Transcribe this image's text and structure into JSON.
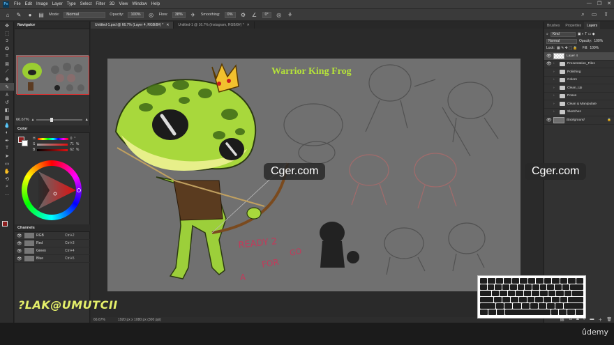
{
  "menu": [
    "File",
    "Edit",
    "Image",
    "Layer",
    "Type",
    "Select",
    "Filter",
    "3D",
    "View",
    "Window",
    "Help"
  ],
  "window_controls": [
    "—",
    "❐",
    "✕"
  ],
  "options": {
    "mode_label": "Mode:",
    "mode_value": "Normal",
    "opacity_label": "Opacity:",
    "opacity_value": "100%",
    "flow_label": "Flow:",
    "flow_value": "38%",
    "smoothing_label": "Smoothing:",
    "smoothing_value": "0%",
    "angle_value": "0°"
  },
  "doc_tabs": [
    "Untitled-1.psd @ 66.7% (Layer 4, RGB/8#) *",
    "Untitled-1 @ 16.7% (Instagram, RGB/8#) *"
  ],
  "navigator": {
    "title": "Navigator",
    "zoom": "66.67%"
  },
  "color": {
    "title": "Color",
    "rows": [
      {
        "label": "H",
        "value": "0",
        "unit": "°"
      },
      {
        "label": "S",
        "value": "71",
        "unit": "%"
      },
      {
        "label": "B",
        "value": "62",
        "unit": "%"
      }
    ],
    "foreground": "#8d1f1f"
  },
  "channels": {
    "title": "Channels",
    "rows": [
      {
        "name": "RGB",
        "shortcut": "Ctrl+2"
      },
      {
        "name": "Red",
        "shortcut": "Ctrl+3"
      },
      {
        "name": "Green",
        "shortcut": "Ctrl+4"
      },
      {
        "name": "Blue",
        "shortcut": "Ctrl+5"
      }
    ]
  },
  "canvas": {
    "title": "Warrior King Frog",
    "note_lines": [
      "READY 2",
      "GO",
      "FOR",
      "A"
    ]
  },
  "status": {
    "zoom": "66.67%",
    "size": "1920 px x 1080 px (300 ppi)"
  },
  "right_tabs": [
    "Brushes",
    "Properties",
    "Layers"
  ],
  "layers_panel": {
    "filter_label": "Kind",
    "blend_mode": "Normal",
    "opacity_label": "Opacity:",
    "opacity_value": "100%",
    "lock_label": "Lock:",
    "fill_label": "Fill:",
    "fill_value": "100%",
    "layers": [
      {
        "name": "Layer 4",
        "type": "layer",
        "selected": true,
        "visible": true
      },
      {
        "name": "Presentation_Files",
        "type": "group",
        "visible": true
      },
      {
        "name": "Polishing",
        "type": "group",
        "visible": false
      },
      {
        "name": "Colors",
        "type": "group",
        "visible": false
      },
      {
        "name": "Clean_Up",
        "type": "group",
        "visible": false
      },
      {
        "name": "Poses",
        "type": "group",
        "visible": false
      },
      {
        "name": "Clean & Manipulate",
        "type": "group",
        "visible": false
      },
      {
        "name": "Sketches",
        "type": "group",
        "visible": false
      },
      {
        "name": "Background",
        "type": "layer",
        "visible": true
      }
    ]
  },
  "watermarks": [
    "Cger.com",
    "Cger.com"
  ],
  "signature": "?LAK@UMUTCII",
  "branding": "ûdemy"
}
